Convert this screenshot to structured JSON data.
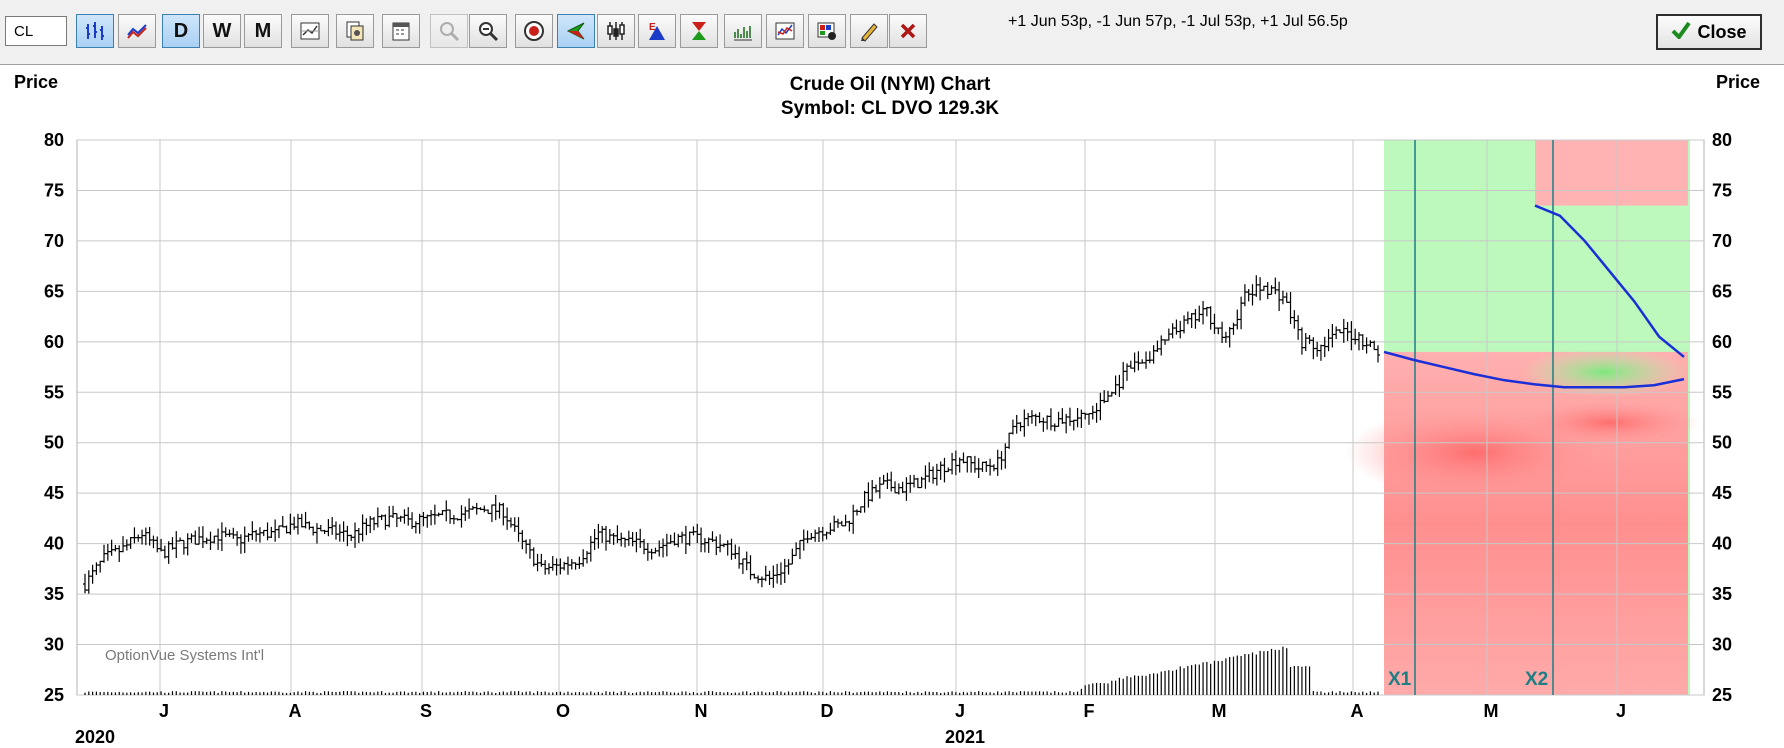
{
  "toolbar": {
    "symbol_value": "CL",
    "legs_text": "+1 Jun 53p, -1 Jun 57p, -1 Jul 53p, +1 Jul 56.5p",
    "close_label": "Close",
    "buttons": [
      {
        "name": "bar-chart-mode-button",
        "icon": "bar-chart-icon",
        "label": "",
        "active": true,
        "disabled": false
      },
      {
        "name": "line-chart-mode-button",
        "icon": "line-chart-icon",
        "label": "",
        "active": false,
        "disabled": false
      },
      {
        "name": "daily-button",
        "icon": "",
        "label": "D",
        "active": true,
        "disabled": false
      },
      {
        "name": "weekly-button",
        "icon": "",
        "label": "W",
        "active": false,
        "disabled": false
      },
      {
        "name": "monthly-button",
        "icon": "",
        "label": "M",
        "active": false,
        "disabled": false
      },
      {
        "name": "chart-settings-button",
        "icon": "chart-settings-icon",
        "label": "",
        "active": false,
        "disabled": false
      },
      {
        "name": "copy-button",
        "icon": "copy-icon",
        "label": "",
        "active": false,
        "disabled": false
      },
      {
        "name": "calendar-button",
        "icon": "calendar-icon",
        "label": "",
        "active": false,
        "disabled": false
      },
      {
        "name": "zoom-in-button",
        "icon": "zoom-in-icon",
        "label": "",
        "active": false,
        "disabled": true
      },
      {
        "name": "zoom-out-button",
        "icon": "zoom-out-icon",
        "label": "",
        "active": false,
        "disabled": false
      },
      {
        "name": "target-button",
        "icon": "target-icon",
        "label": "",
        "active": false,
        "disabled": false
      },
      {
        "name": "arrow-left-button",
        "icon": "arrow-left-icon",
        "label": "",
        "active": true,
        "disabled": false
      },
      {
        "name": "candlestick-button",
        "icon": "candlestick-icon",
        "label": "",
        "active": false,
        "disabled": false
      },
      {
        "name": "earnings-button",
        "icon": "earnings-icon",
        "label": "",
        "active": false,
        "disabled": false
      },
      {
        "name": "hourglass-button",
        "icon": "hourglass-icon",
        "label": "",
        "active": false,
        "disabled": false
      },
      {
        "name": "volume-chart-button",
        "icon": "volume-chart-icon",
        "label": "",
        "active": false,
        "disabled": false
      },
      {
        "name": "indicators-button",
        "icon": "indicators-icon",
        "label": "",
        "active": false,
        "disabled": false
      },
      {
        "name": "palette-button",
        "icon": "palette-icon",
        "label": "",
        "active": false,
        "disabled": false
      },
      {
        "name": "pencil-button",
        "icon": "pencil-icon",
        "label": "",
        "active": false,
        "disabled": false
      },
      {
        "name": "delete-button",
        "icon": "x-icon",
        "label": "",
        "active": false,
        "disabled": false
      }
    ]
  },
  "chart": {
    "title_line1": "Crude Oil (NYM) Chart",
    "title_line2": "Symbol: CL  DVO 129.3K",
    "ylabel_left": "Price",
    "ylabel_right": "Price",
    "watermark": "OptionVue Systems Int'l",
    "marker_x1": "X1",
    "marker_x2": "X2",
    "colors": {
      "profit": "#a7f5a7",
      "loss": "#ff9a9a",
      "projection_line": "#1a2fd6",
      "marker_line": "#1c7f86"
    }
  },
  "chart_data": {
    "type": "bar",
    "subtype": "ohlc-price-with-volume",
    "ylim": [
      25,
      80
    ],
    "yticks": [
      80,
      75,
      70,
      65,
      60,
      55,
      50,
      45,
      40,
      35,
      30,
      25
    ],
    "grid": true,
    "month_labels": [
      "J",
      "A",
      "S",
      "O",
      "N",
      "D",
      "J",
      "F",
      "M",
      "A",
      "M",
      "J"
    ],
    "year_labels": [
      "2020",
      "2021"
    ],
    "weekly_close": [
      36,
      38.5,
      39.5,
      41,
      39,
      40,
      40.5,
      40.8,
      40.3,
      41,
      41,
      42,
      41.5,
      41.2,
      40.8,
      42,
      42.5,
      42.2,
      42.4,
      42.8,
      43,
      43.5,
      43.2,
      40,
      37.5,
      37.8,
      38.5,
      41,
      40.3,
      40,
      39.5,
      40.5,
      40.6,
      40.2,
      39.4,
      37.2,
      36.5,
      38,
      41,
      41.5,
      42,
      44.5,
      45.8,
      45.5,
      46.2,
      47.5,
      48.5,
      47.5,
      48,
      52,
      52.5,
      52.2,
      52.5,
      53,
      55,
      57.5,
      58.5,
      60.5,
      62,
      63,
      60,
      64.5,
      65.5,
      64.5,
      60,
      59.5,
      61,
      60.5,
      59
    ],
    "projection_lower": [
      59,
      58.2,
      57.5,
      56.8,
      56.2,
      55.8,
      55.5,
      55.5,
      55.5,
      55.7,
      56.3
    ],
    "projection_upper": [
      73.5,
      72.5,
      70,
      67,
      64,
      60.5,
      58.5
    ]
  }
}
